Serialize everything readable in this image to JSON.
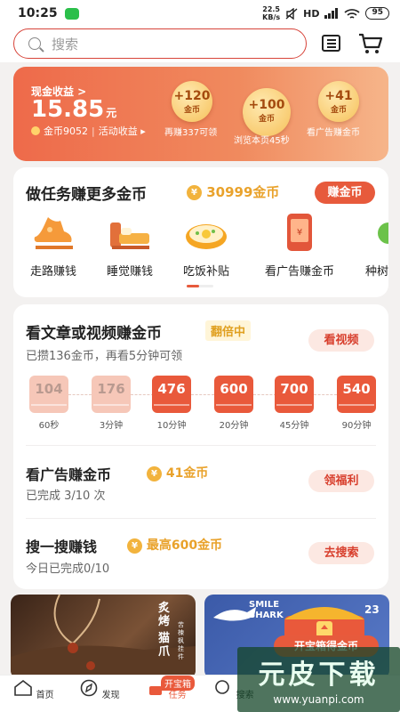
{
  "status_bar": {
    "time": "10:25",
    "speed_top": "22.5",
    "speed_bottom": "KB/s",
    "network": "HD",
    "battery": "95"
  },
  "search": {
    "placeholder": "搜索"
  },
  "earnings": {
    "label": "现金收益 >",
    "amount": "15.85",
    "unit": "元",
    "coins_text": "金币9052",
    "activity_text": "活动收益 ▸",
    "bubbles": [
      {
        "value": "+120",
        "unit": "金币",
        "caption": "再赚337可领"
      },
      {
        "value": "+100",
        "unit": "金币",
        "caption": "浏览本页45秒"
      },
      {
        "value": "+41",
        "unit": "金币",
        "caption": "看广告赚金币"
      }
    ]
  },
  "tasks": {
    "title": "做任务赚更多金币",
    "coin_symbol": "¥",
    "coin_count": "30999金币",
    "button": "赚金币",
    "items": [
      {
        "label": "走路赚钱",
        "icon": "shoe-icon"
      },
      {
        "label": "睡觉赚钱",
        "icon": "bed-icon"
      },
      {
        "label": "吃饭补贴",
        "icon": "meal-icon"
      },
      {
        "label": "看广告赚金币",
        "icon": "ad-phone-icon"
      },
      {
        "label": "种树",
        "icon": "tree-icon"
      }
    ]
  },
  "article": {
    "title": "看文章或视频赚金币",
    "badge": "翻倍中",
    "desc": "已攒136金币，再看5分钟可领",
    "button": "看视频",
    "steps": [
      {
        "value": "104",
        "time": "60秒",
        "active": false
      },
      {
        "value": "176",
        "time": "3分钟",
        "active": false
      },
      {
        "value": "476",
        "time": "10分钟",
        "active": true
      },
      {
        "value": "600",
        "time": "20分钟",
        "active": true
      },
      {
        "value": "700",
        "time": "45分钟",
        "active": true
      },
      {
        "value": "540",
        "time": "90分钟",
        "active": true
      }
    ]
  },
  "ad_task": {
    "title": "看广告赚金币",
    "coin": "41金币",
    "desc": "已完成 3/10 次",
    "button": "领福利"
  },
  "search_task": {
    "title": "搜一搜赚钱",
    "coin": "最高600金币",
    "desc": "今日已完成0/10",
    "button": "去搜索"
  },
  "banners": {
    "left_text_1": "炙烤",
    "left_text_2": "猫爪",
    "left_text_side": "苦楝枫挂件",
    "right_text_brand_1": "SMILE",
    "right_text_brand_2": "SHARK",
    "right_text_num": "23",
    "right_button": "开宝箱得金币"
  },
  "nav": {
    "items": [
      {
        "label": "首页",
        "icon": "home-icon"
      },
      {
        "label": "发现",
        "icon": "compass-icon"
      },
      {
        "label": "任务",
        "icon": "task-icon"
      },
      {
        "label": "搜索",
        "icon": "search-icon"
      }
    ],
    "treasure_tag": "开宝箱"
  },
  "watermark": {
    "text": "元皮下载",
    "url": "www.yuanpi.com"
  },
  "colors": {
    "accent": "#e9593b",
    "coin": "#e9a22b",
    "card_bg": "#ffffff"
  }
}
